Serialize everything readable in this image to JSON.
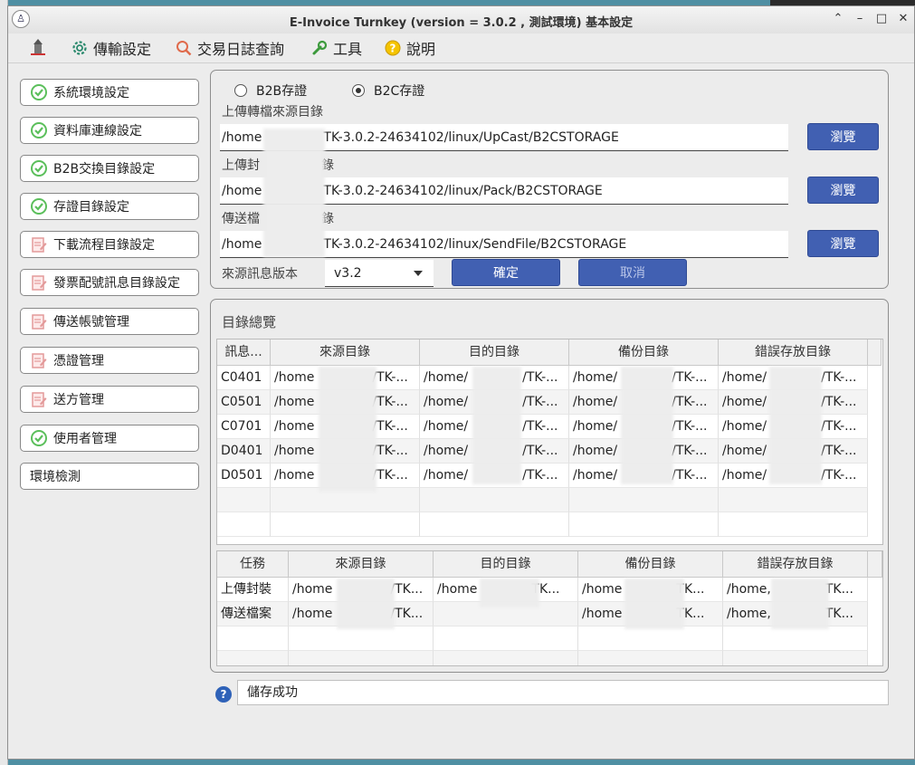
{
  "window": {
    "title": "E-Invoice Turnkey (version = 3.0.2 , 測試環境) 基本設定"
  },
  "menu": [
    {
      "label": "傳輸設定",
      "icon": "gear-icon"
    },
    {
      "label": "交易日誌查詢",
      "icon": "magnifier-icon"
    },
    {
      "label": "工具",
      "icon": "wrench-icon"
    },
    {
      "label": "說明",
      "icon": "help-icon"
    }
  ],
  "sidebar": [
    {
      "label": "系統環境設定",
      "status": "done"
    },
    {
      "label": "資料庫連線設定",
      "status": "done"
    },
    {
      "label": "B2B交換目錄設定",
      "status": "done"
    },
    {
      "label": "存證目錄設定",
      "status": "done"
    },
    {
      "label": "下載流程目錄設定",
      "status": "todo"
    },
    {
      "label": "發票配號訊息目錄設定",
      "status": "todo"
    },
    {
      "label": "傳送帳號管理",
      "status": "todo"
    },
    {
      "label": "憑證管理",
      "status": "todo"
    },
    {
      "label": "送方管理",
      "status": "todo"
    },
    {
      "label": "使用者管理",
      "status": "done"
    },
    {
      "label": "環境檢測",
      "status": "none"
    }
  ],
  "storage": {
    "radio_b2b": "B2B存證",
    "radio_b2c": "B2C存證",
    "selected": "B2C存證",
    "upload_source_label": "上傳轉檔來源目錄",
    "upload_source_path": "/home",
    "upload_source_tail": "TK-3.0.2-24634102/linux/UpCast/B2CSTORAGE",
    "pack_label": "上傳封",
    "pack_label_tail": "錄",
    "pack_path": "/home",
    "pack_tail": "TK-3.0.2-24634102/linux/Pack/B2CSTORAGE",
    "send_label": "傳送檔",
    "send_label_tail": "錄",
    "send_path": "/home",
    "send_tail": "TK-3.0.2-24634102/linux/SendFile/B2CSTORAGE",
    "browse": "瀏覽",
    "version_label": "來源訊息版本",
    "version_value": "v3.2",
    "confirm": "確定",
    "cancel": "取消"
  },
  "overview": {
    "title": "目錄總覽",
    "table1": {
      "headers": [
        "訊息...",
        "來源目錄",
        "目的目錄",
        "備份目錄",
        "錯誤存放目錄"
      ],
      "rows": [
        [
          "C0401",
          "/home",
          "/TK-...",
          "/home/",
          "/TK-...",
          "/home/",
          "/TK-...",
          "/home/",
          "/TK-..."
        ],
        [
          "C0501",
          "/home",
          "/TK-...",
          "/home/",
          "/TK-...",
          "/home/",
          "/TK-...",
          "/home/",
          "/TK-..."
        ],
        [
          "C0701",
          "/home",
          "/TK-...",
          "/home/",
          "/TK-...",
          "/home/",
          "/TK-...",
          "/home/",
          "/TK-..."
        ],
        [
          "D0401",
          "/home",
          "/TK-...",
          "/home/",
          "/TK-...",
          "/home/",
          "/TK-...",
          "/home/",
          "/TK-..."
        ],
        [
          "D0501",
          "/home",
          "/TK-...",
          "/home/",
          "/TK-...",
          "/home/",
          "/TK-...",
          "/home/",
          "/TK-..."
        ]
      ]
    },
    "table2": {
      "headers": [
        "任務",
        "來源目錄",
        "目的目錄",
        "備份目錄",
        "錯誤存放目錄"
      ],
      "rows": [
        [
          "上傳封裝",
          "/home",
          "/TK...",
          "/home",
          "TK...",
          "/home",
          "TK...",
          "/home,",
          "TK..."
        ],
        [
          "傳送檔案",
          "/home",
          "/TK...",
          "",
          "",
          "/home",
          "TK...",
          "/home,",
          "TK..."
        ]
      ]
    }
  },
  "status": {
    "message": "儲存成功"
  }
}
